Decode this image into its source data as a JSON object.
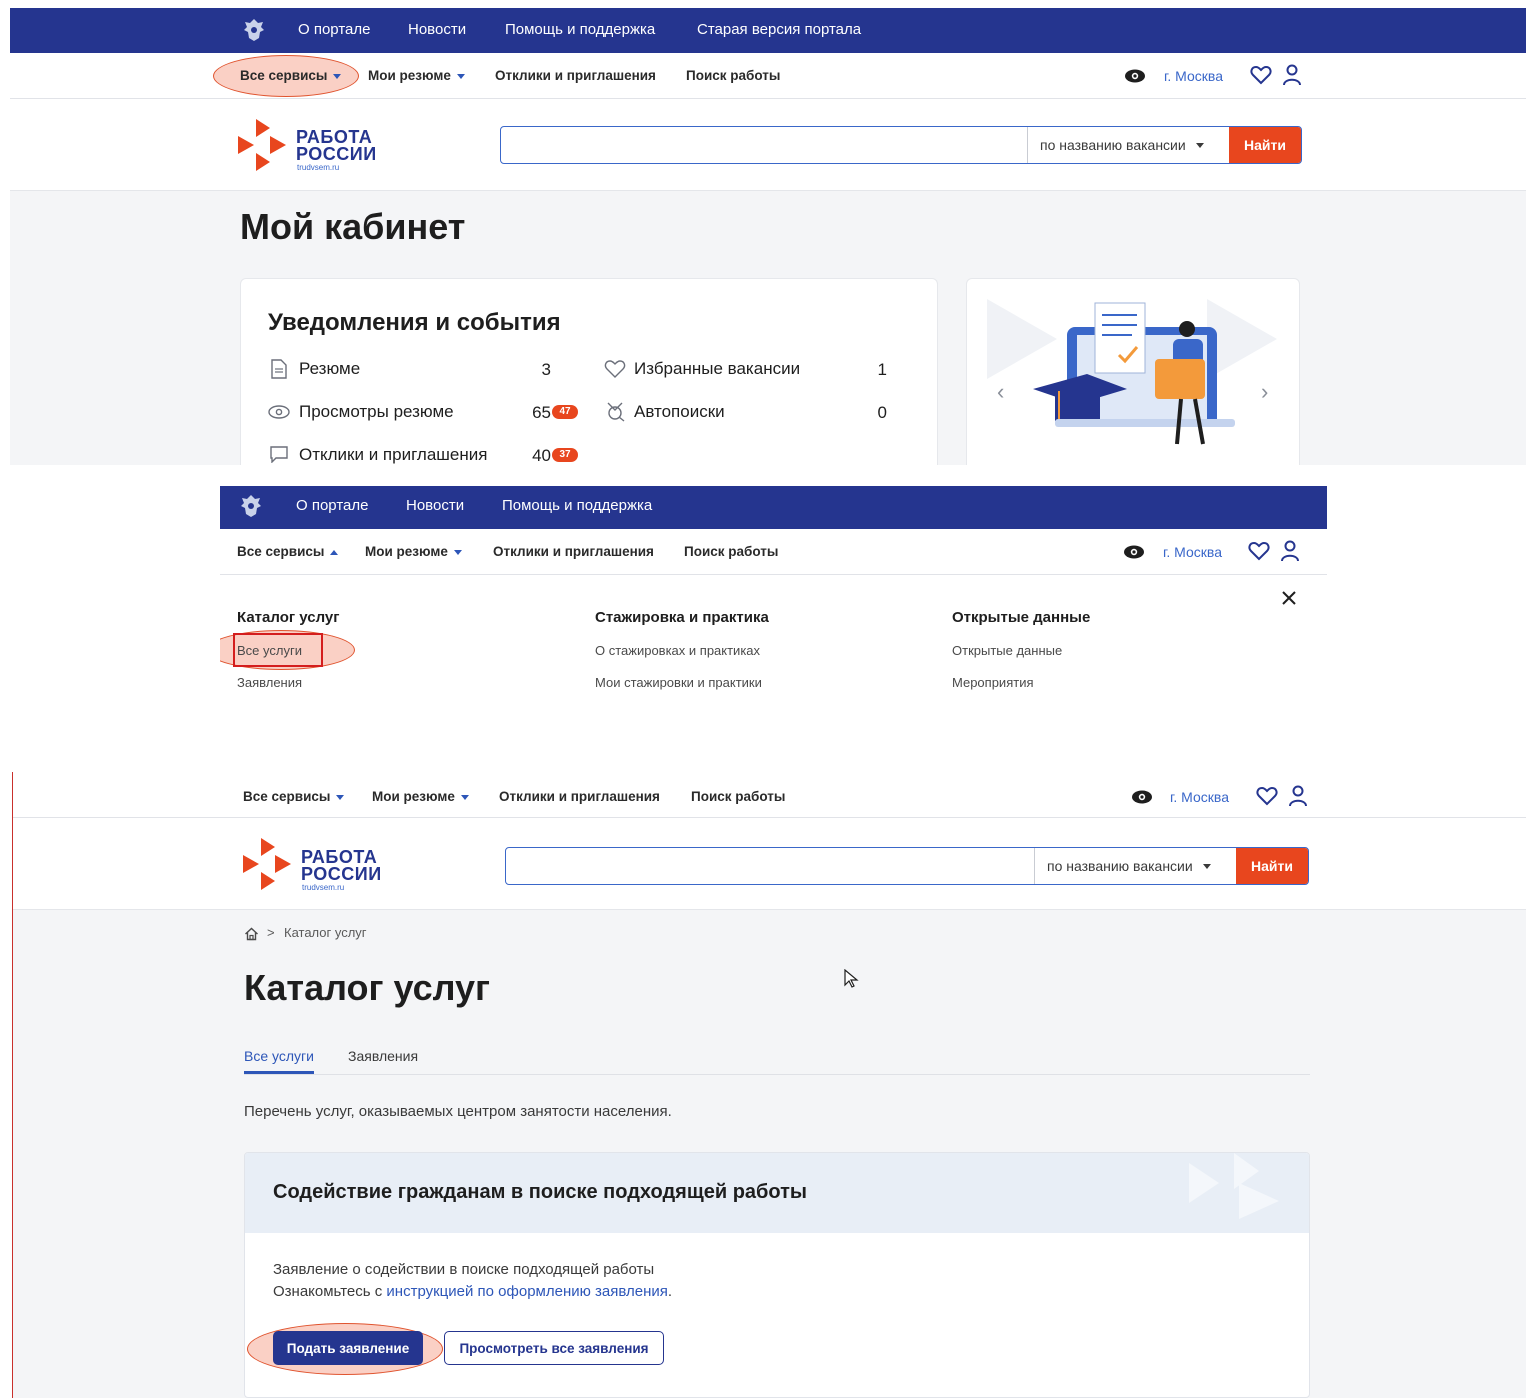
{
  "top_nav": [
    "О портале",
    "Новости",
    "Помощь и поддержка",
    "Старая версия портала"
  ],
  "main_nav": {
    "all_services": "Все сервисы",
    "my_resume": "Мои резюме",
    "responses": "Отклики и приглашения",
    "job_search": "Поиск работы",
    "city": "г. Москва"
  },
  "logo": {
    "line1": "РАБОТА",
    "line2": "РОССИИ",
    "domain": "trudvsem.ru"
  },
  "search": {
    "value": "",
    "type": "по названию вакансии",
    "button": "Найти"
  },
  "cabinet": {
    "title": "Мой кабинет",
    "notifications": {
      "title": "Уведомления и события",
      "items": [
        {
          "label": "Резюме",
          "value": "3",
          "badge": "",
          "icon": "document-icon"
        },
        {
          "label": "Просмотры резюме",
          "value": "65",
          "badge": "47",
          "icon": "eye-icon"
        },
        {
          "label": "Отклики и приглашения",
          "value": "40",
          "badge": "37",
          "icon": "chat-icon"
        },
        {
          "label": "Избранные вакансии",
          "value": "1",
          "badge": "",
          "icon": "heart-icon"
        },
        {
          "label": "Автопоиски",
          "value": "0",
          "badge": "",
          "icon": "autosearch-icon"
        }
      ]
    }
  },
  "services_menu": {
    "columns": [
      {
        "title": "Каталог услуг",
        "links": [
          "Все услуги",
          "Заявления"
        ]
      },
      {
        "title": "Стажировка и практика",
        "links": [
          "О стажировках и практиках",
          "Мои стажировки и практики"
        ]
      },
      {
        "title": "Открытые данные",
        "links": [
          "Открытые данные",
          "Мероприятия"
        ]
      }
    ]
  },
  "catalog": {
    "breadcrumb": "Каталог услуг",
    "title": "Каталог услуг",
    "tabs": [
      "Все услуги",
      "Заявления"
    ],
    "intro": "Перечень услуг, оказываемых центром занятости населения.",
    "service": {
      "title": "Содействие гражданам в поиске подходящей работы",
      "line1": "Заявление о содействии в поиске подходящей работы",
      "line2_prefix": "Ознакомьтесь с ",
      "line2_link": "инструкцией по оформлению заявления",
      "line2_suffix": ".",
      "primary_button": "Подать заявление",
      "secondary_button": "Просмотреть все заявления"
    }
  },
  "colors": {
    "brand_blue": "#25358f",
    "accent_orange": "#e8461e",
    "link_blue": "#3a67c9"
  }
}
